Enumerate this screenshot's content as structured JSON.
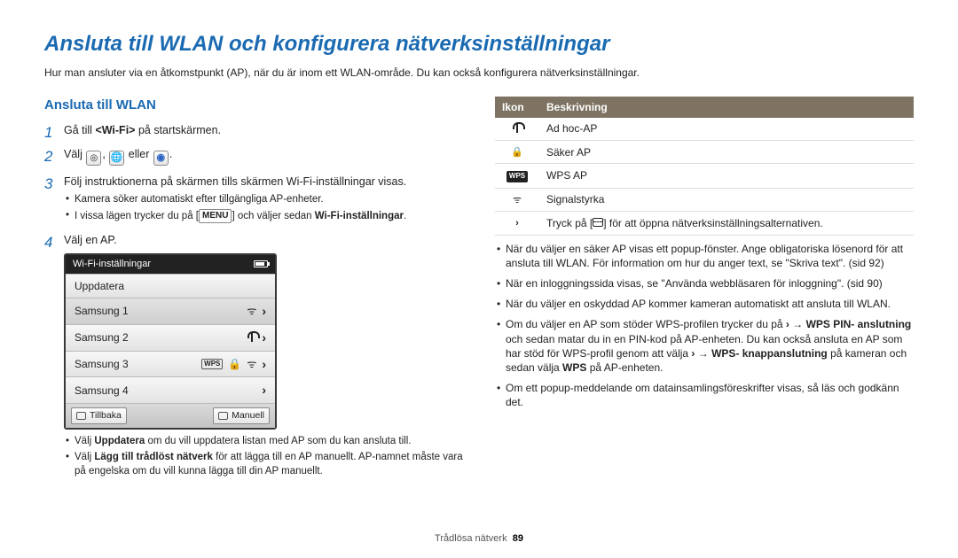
{
  "title": "Ansluta till WLAN och konfigurera nätverksinställningar",
  "intro": "Hur man ansluter via en åtkomstpunkt (AP), när du är inom ett WLAN-område. Du kan också konfigurera nätverksinställningar.",
  "section_heading": "Ansluta till WLAN",
  "steps": {
    "s1_a": "Gå till ",
    "s1_b": "<Wi-Fi>",
    "s1_c": " på startskärmen.",
    "s2_a": "Välj ",
    "s2_b": ", ",
    "s2_c": " eller ",
    "s2_d": ".",
    "s3": "Följ instruktionerna på skärmen tills skärmen Wi-Fi-inställningar visas.",
    "s4": "Välj en AP."
  },
  "sub3": {
    "a": "Kamera söker automatiskt efter tillgängliga AP-enheter.",
    "b_pre": "I vissa lägen trycker du på [",
    "b_menu": "MENU",
    "b_mid": "] och väljer sedan ",
    "b_bold": "Wi-Fi-inställningar",
    "b_post": "."
  },
  "wifi_panel": {
    "title": "Wi-Fi-inställningar",
    "refresh": "Uppdatera",
    "rows": [
      "Samsung 1",
      "Samsung 2",
      "Samsung 3",
      "Samsung 4"
    ],
    "back": "Tillbaka",
    "manual": "Manuell"
  },
  "tips_left": {
    "a_pre": "Välj ",
    "a_bold": "Uppdatera",
    "a_post": " om du vill uppdatera listan med AP som du kan ansluta till.",
    "b_pre": "Välj ",
    "b_bold": "Lägg till trådlöst nätverk",
    "b_post": " för att lägga till en AP manuellt. AP-namnet måste vara på engelska om du vill kunna lägga till din AP manuellt."
  },
  "table": {
    "h1": "Ikon",
    "h2": "Beskrivning",
    "r1": "Ad hoc-AP",
    "r2": "Säker AP",
    "r3": "WPS AP",
    "r4": "Signalstyrka",
    "r5_pre": "Tryck på [",
    "r5_post": "] för att öppna nätverksinställningsalternativen."
  },
  "right_bullets": {
    "b1": "När du väljer en säker AP visas ett popup-fönster. Ange obligatoriska lösenord för att ansluta till WLAN. För information om hur du anger text, se \"Skriva text\". (sid 92)",
    "b2": "När en inloggningssida visas, se \"Använda webbläsaren för inloggning\". (sid 90)",
    "b3": "När du väljer en oskyddad AP kommer kameran automatiskt att ansluta till WLAN.",
    "b4_a": "Om du väljer en AP som stöder WPS-profilen trycker du på ",
    "b4_b": " → ",
    "b4_c": "WPS PIN- anslutning",
    "b4_d": " och sedan matar du in en PIN-kod på AP-enheten. Du kan också ansluta en AP som har stöd för WPS-profil genom att välja ",
    "b4_e": " → ",
    "b4_f": "WPS- knappanslutning",
    "b4_g": " på kameran och sedan välja ",
    "b4_h": "WPS",
    "b4_i": " på AP-enheten.",
    "b5": "Om ett popup-meddelande om datainsamlingsföreskrifter visas, så läs och godkänn det."
  },
  "footer": {
    "label": "Trådlösa nätverk",
    "page": "89"
  }
}
